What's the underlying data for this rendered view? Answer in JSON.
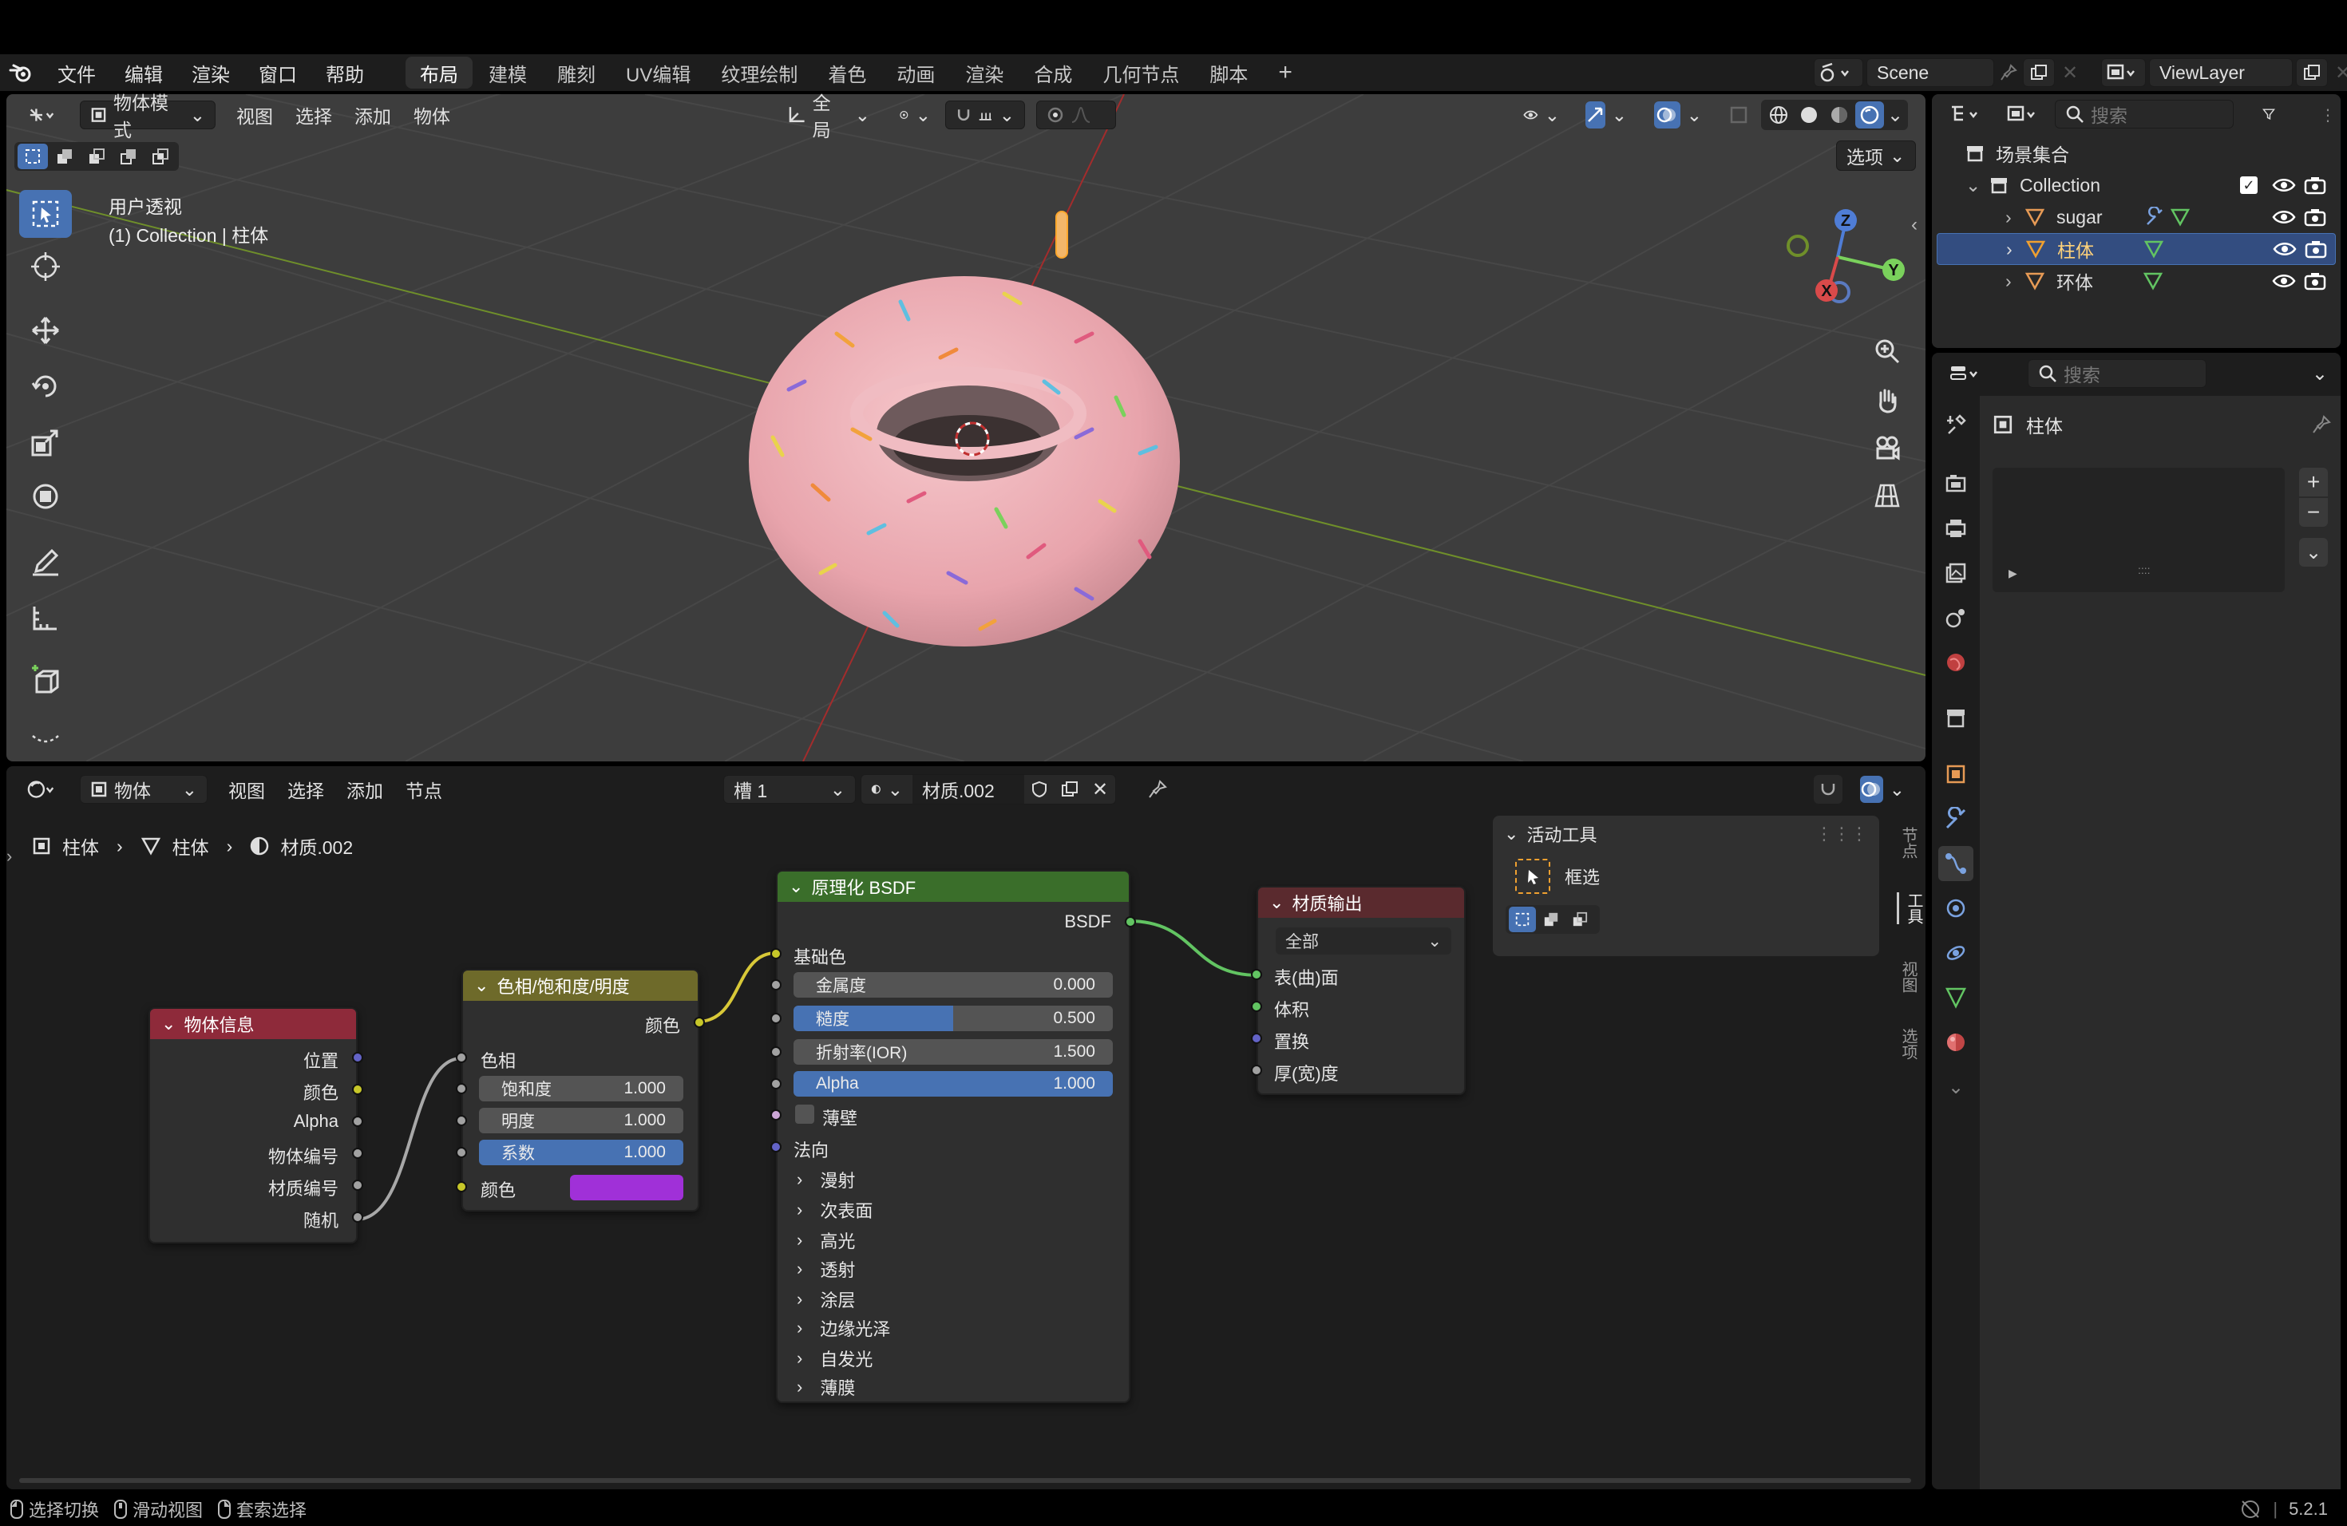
{
  "topbar": {
    "menus": [
      "文件",
      "编辑",
      "渲染",
      "窗口",
      "帮助"
    ],
    "workspaces": [
      "布局",
      "建模",
      "雕刻",
      "UV编辑",
      "纹理绘制",
      "着色",
      "动画",
      "渲染",
      "合成",
      "几何节点",
      "脚本"
    ],
    "active_workspace": "布局",
    "add_workspace": "+",
    "scene": "Scene",
    "view_layer": "ViewLayer"
  },
  "viewport": {
    "mode": "物体模式",
    "menus": [
      "视图",
      "选择",
      "添加",
      "物体"
    ],
    "transform_orientation": "全局",
    "options_label": "选项",
    "view_name": "用户透视",
    "view_subtitle": "(1) Collection | 柱体",
    "gizmo": {
      "x": "X",
      "y": "Y",
      "z": "Z"
    }
  },
  "node_editor": {
    "type": "物体",
    "menus": [
      "视图",
      "选择",
      "添加",
      "节点"
    ],
    "slot": "槽 1",
    "material": "材质.002",
    "breadcrumb": [
      "柱体",
      "柱体",
      "材质.002"
    ],
    "nodes": {
      "object_info": {
        "title": "物体信息",
        "outputs": [
          "位置",
          "颜色",
          "Alpha",
          "物体编号",
          "材质编号",
          "随机"
        ]
      },
      "hsv": {
        "title": "色相/饱和度/明度",
        "output": "颜色",
        "hue_label": "色相",
        "fields": [
          {
            "label": "饱和度",
            "value": "1.000"
          },
          {
            "label": "明度",
            "value": "1.000"
          },
          {
            "label": "系数",
            "value": "1.000"
          }
        ],
        "color_label": "颜色",
        "color_value": "#a030d8"
      },
      "bsdf": {
        "title": "原理化 BSDF",
        "output": "BSDF",
        "base_color": "基础色",
        "fields": [
          {
            "label": "金属度",
            "value": "0.000",
            "fill": 0
          },
          {
            "label": "糙度",
            "value": "0.500",
            "fill": 0.5
          },
          {
            "label": "折射率(IOR)",
            "value": "1.500",
            "fill": 0
          },
          {
            "label": "Alpha",
            "value": "1.000",
            "fill": 1
          }
        ],
        "thin_wall": "薄壁",
        "normal": "法向",
        "panels": [
          "漫射",
          "次表面",
          "高光",
          "透射",
          "涂层",
          "边缘光泽",
          "自发光",
          "薄膜"
        ]
      },
      "output": {
        "title": "材质输出",
        "target": "全部",
        "inputs": [
          "表(曲)面",
          "体积",
          "置换",
          "厚(宽)度"
        ]
      }
    },
    "active_tool_panel": {
      "title": "活动工具",
      "tool": "框选"
    },
    "side_tabs": [
      "节点",
      "工具",
      "视图",
      "选项"
    ]
  },
  "outliner": {
    "search_placeholder": "搜索",
    "scene_collection": "场景集合",
    "collection": "Collection",
    "objects": [
      {
        "name": "sugar",
        "selected": false
      },
      {
        "name": "柱体",
        "selected": true
      },
      {
        "name": "环体",
        "selected": false
      }
    ]
  },
  "properties": {
    "search_placeholder": "搜索",
    "object_name": "柱体"
  },
  "statusbar": {
    "items": [
      "选择切换",
      "滑动视图",
      "套索选择"
    ],
    "version": "5.2.1"
  },
  "colors": {
    "accent": "#4772b3",
    "node_header_object_info": "#8e2a3a",
    "node_header_hsv": "#6e6a2a",
    "node_header_bsdf": "#3a6e2a",
    "node_header_output": "#5a2a2e"
  }
}
